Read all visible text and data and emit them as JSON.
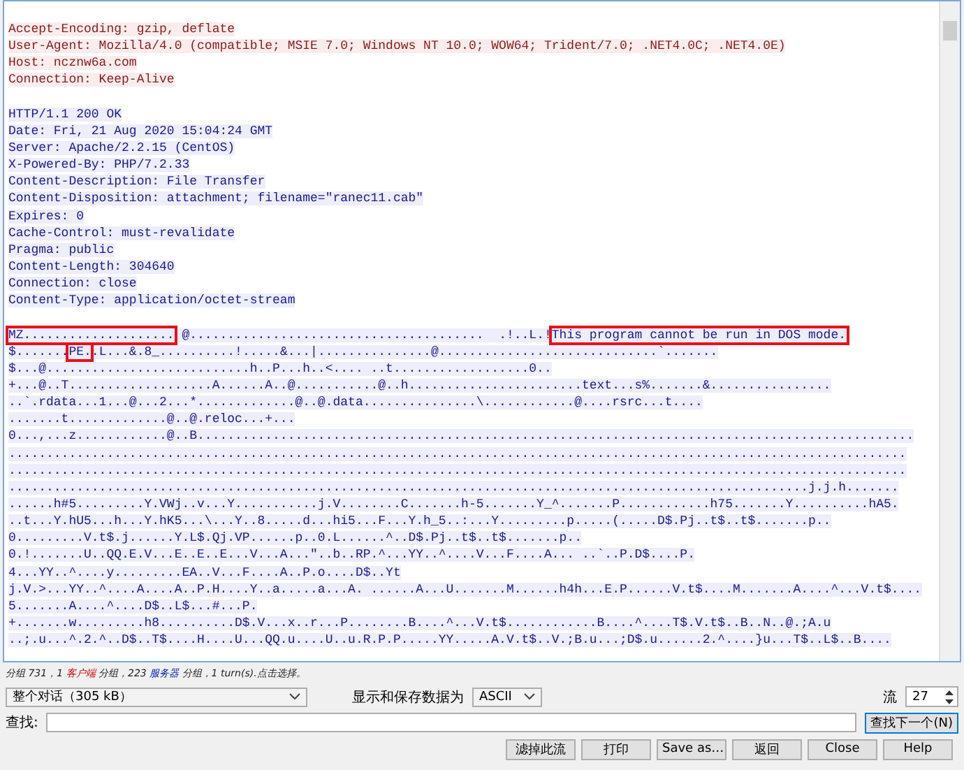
{
  "stream": {
    "lines": [
      {
        "kind": "client",
        "text": "Accept-Encoding: gzip, deflate"
      },
      {
        "kind": "client",
        "text": "User-Agent: Mozilla/4.0 (compatible; MSIE 7.0; Windows NT 10.0; WOW64; Trident/7.0; .NET4.0C; .NET4.0E)"
      },
      {
        "kind": "client",
        "text": "Host: ncznw6a.com"
      },
      {
        "kind": "client",
        "text": "Connection: Keep-Alive"
      },
      {
        "kind": "gap"
      },
      {
        "kind": "server",
        "text": "HTTP/1.1 200 OK"
      },
      {
        "kind": "server",
        "text": "Date: Fri, 21 Aug 2020 15:04:24 GMT"
      },
      {
        "kind": "server",
        "text": "Server: Apache/2.2.15 (CentOS)"
      },
      {
        "kind": "server",
        "text": "X-Powered-By: PHP/7.2.33"
      },
      {
        "kind": "server",
        "text": "Content-Description: File Transfer"
      },
      {
        "kind": "server",
        "text": "Content-Disposition: attachment; filename=\"ranec11.cab\""
      },
      {
        "kind": "server",
        "text": "Expires: 0"
      },
      {
        "kind": "server",
        "text": "Cache-Control: must-revalidate"
      },
      {
        "kind": "server",
        "text": "Pragma: public"
      },
      {
        "kind": "server",
        "text": "Content-Length: 304640"
      },
      {
        "kind": "server",
        "text": "Connection: close"
      },
      {
        "kind": "server",
        "text": "Content-Type: application/octet-stream"
      },
      {
        "kind": "gap"
      },
      {
        "kind": "server",
        "segments": [
          {
            "text": "MZ....................",
            "boxed": true
          },
          {
            "text": " @.......................................  .!..L.!",
            "boxed": false
          },
          {
            "text": "This program cannot be run in DOS mode.",
            "boxed": true
          }
        ]
      },
      {
        "kind": "server",
        "segments": [
          {
            "text": "$.......",
            "boxed": false
          },
          {
            "text": "PE.",
            "boxed": true
          },
          {
            "text": ".L...&.8_..........!.....&...|...............@.............................`.......",
            "boxed": false
          }
        ]
      },
      {
        "kind": "server",
        "text": "$...@...........................h..P...h..<.... ..t..................0.."
      },
      {
        "kind": "server",
        "text": "+...@..T...................A......A..@...........@..h.......................text...s%.......&................"
      },
      {
        "kind": "server",
        "text": "..`.rdata...1...@...2...*.............@..@.data...............\\............@....rsrc...t...."
      },
      {
        "kind": "server",
        "text": ".......t.............@..@.reloc...+..."
      },
      {
        "kind": "server",
        "text": "0...,...z............@..B..............................................................................................."
      },
      {
        "kind": "server",
        "text": "......................................................................................................................."
      },
      {
        "kind": "server",
        "text": "......................................................................................................................."
      },
      {
        "kind": "server",
        "text": "..........................................................................................................j.j.h......."
      },
      {
        "kind": "server",
        "text": "......h#5.........Y.VWj..v...Y...........j.V........C.......h-5.......Y_^.......P............h75.......Y..........hA5."
      },
      {
        "kind": "server",
        "text": "..t...Y.hU5...h...Y.hK5...\\...Y..8.....d...hi5...F...Y.h_5..:...Y.........p.....(.....D$.Pj..t$..t$.......p.."
      },
      {
        "kind": "server",
        "text": "0.........V.t$.j......Y.L$.Qj.VP......p..0.L......^..D$.Pj..t$..t$.......p.."
      },
      {
        "kind": "server",
        "text": "0.!.......U..QQ.E.V...E..E..E...V...A...\"..b..RP.^...YY..^....V...F....A... ..`..P.D$....P."
      },
      {
        "kind": "server",
        "text": "4...YY..^....y.........EA..V...F....A..P.o....D$..Yt"
      },
      {
        "kind": "server",
        "text": "j.V.>...YY..^....A....A..P.H....Y..a.....a...A. ......A...U.......M......h4h...E.P......V.t$....M.......A....^...V.t$...."
      },
      {
        "kind": "server",
        "text": "5.......A....^....D$..L$...#...P."
      },
      {
        "kind": "server",
        "text": "+.......w.........h8..........D$.V...x..r...P........B....^...V.t$............B....^....T$.V.t$..B..N..@.;A.u"
      },
      {
        "kind": "server",
        "text": "..;.u...^.2.^..D$..T$....H....U...QQ.u....U..u.R.P.P.....YY.....A.V.t$..V.;B.u...;D$.u......2.^....}u...T$..L$..B...."
      }
    ]
  },
  "status": [
    {
      "kind": "plain",
      "text": "分组 731，1 "
    },
    {
      "kind": "client",
      "text": "客户端"
    },
    {
      "kind": "plain",
      "text": " 分组，223 "
    },
    {
      "kind": "server",
      "text": "服务器"
    },
    {
      "kind": "plain",
      "text": " 分组，1 turn(s).点击选择。"
    }
  ],
  "conversation_select": {
    "value": "整个对话（305 kB）"
  },
  "format_label": "显示和保存数据为",
  "format_select": {
    "value": "ASCII"
  },
  "stream_label": "流",
  "stream_spin": {
    "value": "27"
  },
  "find_label": "查找:",
  "find_next_button": "查找下一个(N)",
  "buttons": [
    "滤掉此流",
    "打印",
    "Save as…",
    "返回",
    "Close",
    "Help"
  ]
}
